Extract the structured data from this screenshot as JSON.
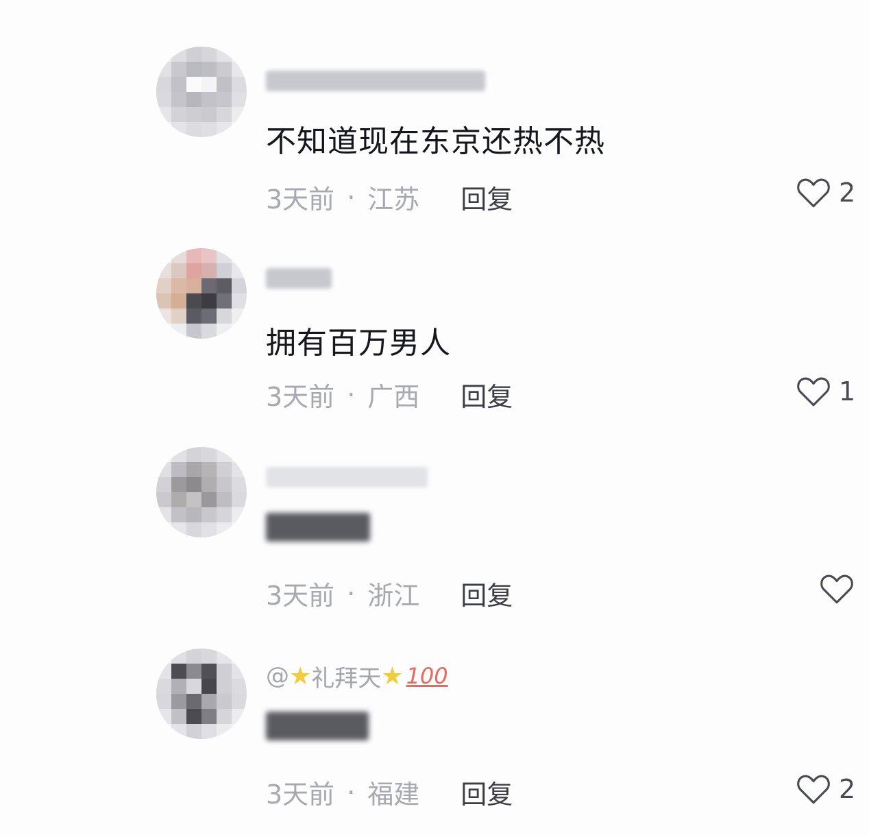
{
  "comments": [
    {
      "username": "",
      "content": "不知道现在东京还热不热",
      "time": "3天前",
      "separator": "·",
      "location": "江苏",
      "reply_label": "回复",
      "likes": "2"
    },
    {
      "username": "",
      "content": "拥有百万男人",
      "time": "3天前",
      "separator": "·",
      "location": "广西",
      "reply_label": "回复",
      "likes": "1"
    },
    {
      "username": "",
      "content": "",
      "time": "3天前",
      "separator": "·",
      "location": "浙江",
      "reply_label": "回复",
      "likes": ""
    },
    {
      "username_prefix": "@",
      "username_name": "礼拜天",
      "username_suffix": "100",
      "content": "",
      "time": "3天前",
      "separator": "·",
      "location": "福建",
      "reply_label": "回复",
      "likes": "2"
    }
  ],
  "icons": {
    "like": "heart-outline-icon",
    "star": "star-emoji-icon",
    "hundred": "hundred-points-emoji-icon"
  },
  "colors": {
    "content_text": "#16171c",
    "meta_text": "#a8a9b0",
    "username_text": "#a4a6ae",
    "reply_text": "#3d3e44",
    "background": "#fdfdfe"
  }
}
